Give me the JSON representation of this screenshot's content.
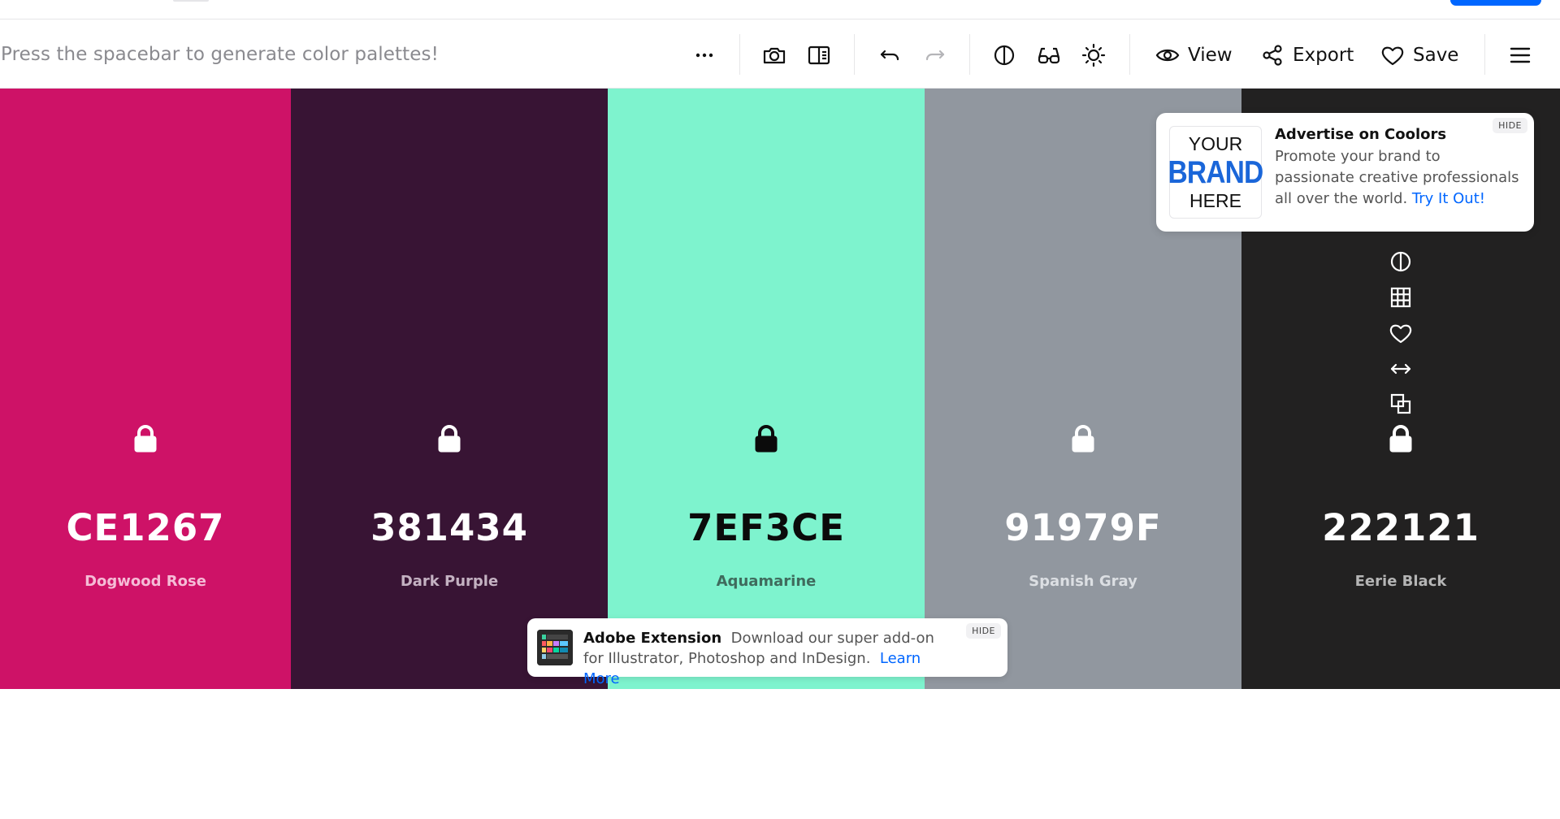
{
  "toolbar": {
    "hint": "Press the spacebar to generate color palettes!",
    "view_label": "View",
    "export_label": "Export",
    "save_label": "Save"
  },
  "palette": [
    {
      "hex": "CE1267",
      "name": "Dogwood Rose",
      "bg": "#CE1267",
      "fg": "#ffffff",
      "sub": "#f5bcd6"
    },
    {
      "hex": "381434",
      "name": "Dark Purple",
      "bg": "#381434",
      "fg": "#ffffff",
      "sub": "#c4b2c2"
    },
    {
      "hex": "7EF3CE",
      "name": "Aquamarine",
      "bg": "#7EF3CE",
      "fg": "#0b0b0b",
      "sub": "#3f6b5d"
    },
    {
      "hex": "91979F",
      "name": "Spanish Gray",
      "bg": "#91979F",
      "fg": "#ffffff",
      "sub": "#dcdfe3"
    },
    {
      "hex": "222121",
      "name": "Eerie Black",
      "bg": "#222121",
      "fg": "#ffffff",
      "sub": "#b5b5b5"
    }
  ],
  "ad": {
    "logo_line1": "YOUR",
    "logo_line2": "BRAND",
    "logo_line3": "HERE",
    "title": "Advertise on Coolors",
    "body": "Promote your brand to passionate creative professionals all over the world.",
    "link": "Try It Out!",
    "hide_label": "HIDE"
  },
  "adobe": {
    "title": "Adobe Extension",
    "body": "Download our super add-on for Illustrator, Photoshop and InDesign.",
    "link": "Learn More",
    "hide_label": "HIDE"
  },
  "colors": {
    "accent": "#0066ff",
    "divider": "#e6e6e8"
  }
}
